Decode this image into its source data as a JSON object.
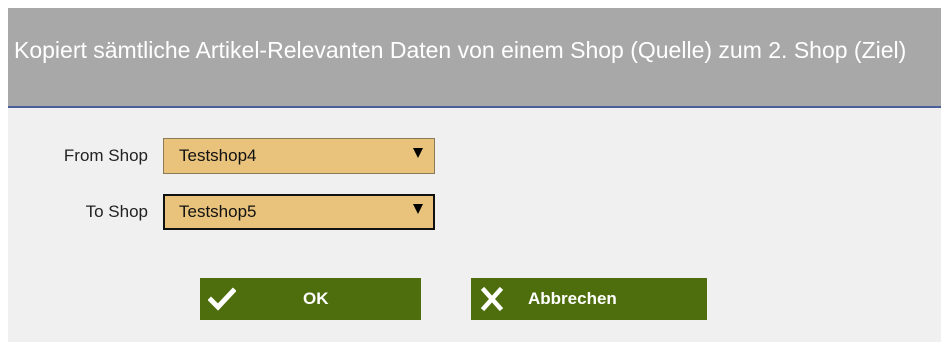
{
  "dialog": {
    "title": "Kopiert sämtliche Artikel-Relevanten Daten von einem Shop (Quelle) zum 2. Shop (Ziel)"
  },
  "form": {
    "from_label": "From Shop",
    "from_value": "Testshop4",
    "to_label": "To Shop",
    "to_value": "Testshop5"
  },
  "buttons": {
    "ok_label": "OK",
    "ok_icon": "checkmark-icon",
    "cancel_label": "Abbrechen",
    "cancel_icon": "close-icon"
  },
  "colors": {
    "header_bg": "#a8a8a8",
    "header_border": "#4a5f9a",
    "select_bg": "#e9c37c",
    "button_bg": "#4e6e0d",
    "dialog_bg": "#f0f0f0"
  }
}
